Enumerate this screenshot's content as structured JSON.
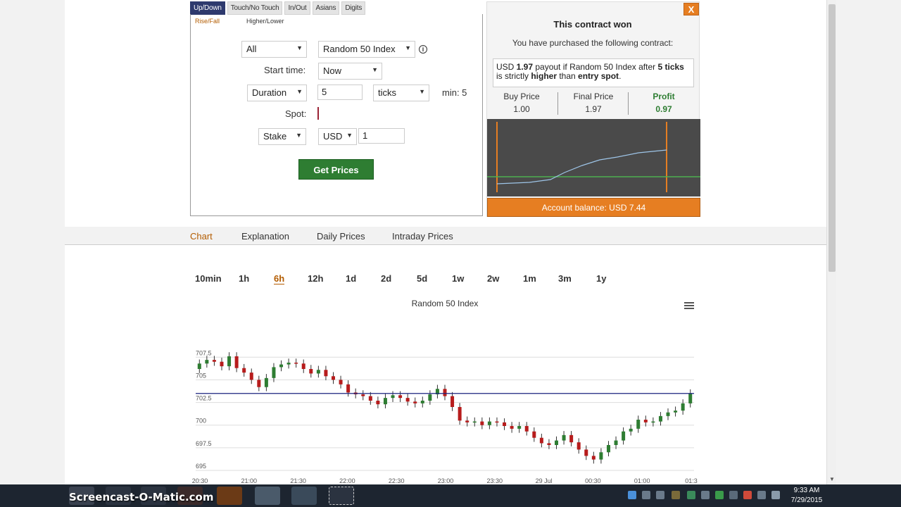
{
  "trade_tabs": [
    {
      "label": "Up/Down",
      "active": true
    },
    {
      "label": "Touch/No Touch",
      "active": false
    },
    {
      "label": "In/Out",
      "active": false
    },
    {
      "label": "Asians",
      "active": false
    },
    {
      "label": "Digits",
      "active": false
    }
  ],
  "trade_subtabs": [
    {
      "label": "Rise/Fall",
      "active": true
    },
    {
      "label": "Higher/Lower",
      "active": false
    }
  ],
  "form": {
    "market_filter": "All",
    "underlying": "Random 50 Index",
    "start_time_label": "Start time:",
    "start_time": "Now",
    "duration_type": "Duration",
    "duration_value": "5",
    "duration_unit": "ticks",
    "duration_min": "min: 5",
    "spot_label": "Spot:",
    "amount_type": "Stake",
    "currency": "USD",
    "amount": "1",
    "get_prices": "Get Prices"
  },
  "contract": {
    "title": "This contract won",
    "subtitle": "You have purchased the following contract:",
    "desc_prefix": "USD ",
    "payout": "1.97",
    "desc_mid": " payout if Random 50 Index after ",
    "ticks": "5 ticks",
    "desc_mid2": " is strictly ",
    "higher": "higher",
    "desc_mid3": " than ",
    "entry_spot": "entry spot",
    "desc_end": ".",
    "buy_price_label": "Buy Price",
    "buy_price": "1.00",
    "final_price_label": "Final Price",
    "final_price": "1.97",
    "profit_label": "Profit",
    "profit": "0.97",
    "balance": "Account balance: USD 7.44",
    "close": "X"
  },
  "nav_tabs": [
    {
      "label": "Chart",
      "active": true
    },
    {
      "label": "Explanation",
      "active": false
    },
    {
      "label": "Daily Prices",
      "active": false
    },
    {
      "label": "Intraday Prices",
      "active": false
    }
  ],
  "periods": [
    {
      "label": "10min",
      "active": false
    },
    {
      "label": "1h",
      "active": false
    },
    {
      "label": "6h",
      "active": true
    },
    {
      "label": "12h",
      "active": false
    },
    {
      "label": "1d",
      "active": false
    },
    {
      "label": "2d",
      "active": false
    },
    {
      "label": "5d",
      "active": false
    },
    {
      "label": "1w",
      "active": false
    },
    {
      "label": "2w",
      "active": false
    },
    {
      "label": "1m",
      "active": false
    },
    {
      "label": "3m",
      "active": false
    },
    {
      "label": "1y",
      "active": false
    }
  ],
  "chart_data": {
    "type": "candlestick",
    "title": "Random 50 Index",
    "y_ticks": [
      "707.5",
      "705",
      "702.5",
      "700",
      "697.5",
      "695"
    ],
    "ylim": [
      695,
      709
    ],
    "x_ticks": [
      "20:30",
      "21:00",
      "21:30",
      "22:00",
      "22:30",
      "23:00",
      "23:30",
      "29 Jul",
      "00:30",
      "01:00",
      "01:3"
    ],
    "close": [
      706.8,
      707.2,
      707.0,
      706.5,
      707.6,
      706.3,
      705.8,
      705.0,
      704.2,
      705.2,
      706.4,
      706.7,
      706.9,
      706.8,
      706.2,
      705.7,
      706.1,
      705.4,
      705.0,
      704.5,
      703.6,
      703.4,
      703.2,
      702.7,
      702.3,
      703.0,
      703.3,
      703.0,
      702.6,
      702.4,
      702.7,
      703.4,
      704.0,
      703.2,
      702.0,
      700.5,
      700.3,
      700.4,
      700.0,
      700.4,
      700.3,
      699.9,
      699.6,
      699.9,
      699.3,
      698.6,
      698.0,
      697.8,
      698.3,
      698.9,
      698.1,
      697.3,
      696.6,
      696.2,
      697.0,
      697.8,
      698.3,
      699.3,
      699.6,
      700.6,
      700.3,
      700.4,
      701.0,
      701.4,
      701.6,
      702.4,
      703.5
    ],
    "open": [
      706.2,
      706.8,
      707.2,
      707.0,
      706.5,
      707.6,
      706.3,
      705.8,
      705.0,
      704.2,
      705.2,
      706.4,
      706.7,
      706.9,
      706.8,
      706.2,
      705.7,
      706.1,
      705.4,
      705.0,
      704.5,
      703.6,
      703.4,
      703.2,
      702.7,
      702.3,
      703.0,
      703.3,
      703.0,
      702.6,
      702.4,
      702.7,
      703.4,
      704.0,
      703.2,
      702.0,
      700.5,
      700.3,
      700.4,
      700.0,
      700.4,
      700.3,
      699.9,
      699.6,
      699.9,
      699.3,
      698.6,
      698.0,
      697.8,
      698.3,
      698.9,
      698.1,
      697.3,
      696.6,
      696.2,
      697.0,
      697.8,
      698.3,
      699.3,
      699.6,
      700.6,
      700.3,
      700.4,
      701.0,
      701.4,
      701.6,
      702.4
    ],
    "reference_line": 703.5
  },
  "taskbar": {
    "watermark": "Screencast-O-Matic.com",
    "time": "9:33 AM",
    "date": "7/29/2015"
  },
  "colors": {
    "accent": "#e67e22",
    "active_tab": "#2e3a6e",
    "button": "#2e7d32",
    "up_candle": "#2e7d32",
    "down_candle": "#b71c1c",
    "reference_line": "#1a237e"
  }
}
